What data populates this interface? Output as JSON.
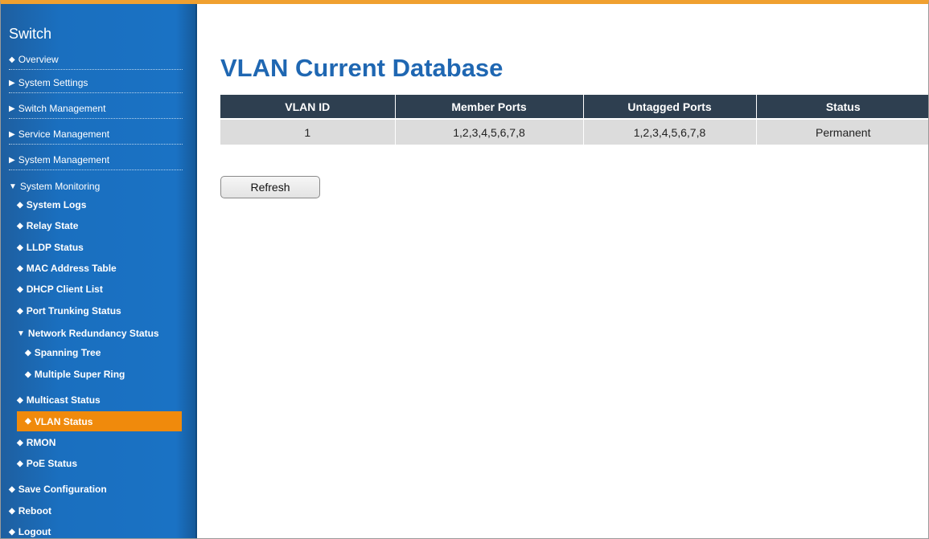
{
  "sidebar": {
    "title": "Switch",
    "items": [
      {
        "marker": "◆",
        "label": "Overview"
      },
      {
        "marker": "▶",
        "label": "System Settings"
      },
      {
        "marker": "▶",
        "label": "Switch Management"
      },
      {
        "marker": "▶",
        "label": "Service Management"
      },
      {
        "marker": "▶",
        "label": "System Management"
      },
      {
        "marker": "▼",
        "label": "System Monitoring"
      },
      {
        "marker": "◆",
        "label": "System Logs"
      },
      {
        "marker": "◆",
        "label": "Relay State"
      },
      {
        "marker": "◆",
        "label": "LLDP Status"
      },
      {
        "marker": "◆",
        "label": "MAC Address Table"
      },
      {
        "marker": "◆",
        "label": "DHCP Client List"
      },
      {
        "marker": "◆",
        "label": "Port Trunking Status"
      },
      {
        "marker": "▼",
        "label": "Network Redundancy Status"
      },
      {
        "marker": "◆",
        "label": "Spanning Tree"
      },
      {
        "marker": "◆",
        "label": "Multiple Super Ring"
      },
      {
        "marker": "◆",
        "label": "Multicast Status"
      },
      {
        "marker": "◆",
        "label": "VLAN Status"
      },
      {
        "marker": "◆",
        "label": "RMON"
      },
      {
        "marker": "◆",
        "label": "PoE Status"
      },
      {
        "marker": "◆",
        "label": "Save Configuration"
      },
      {
        "marker": "◆",
        "label": "Reboot"
      },
      {
        "marker": "◆",
        "label": "Logout"
      }
    ]
  },
  "main": {
    "title": "VLAN Current Database",
    "table": {
      "headers": [
        "VLAN ID",
        "Member Ports",
        "Untagged Ports",
        "Status"
      ],
      "rows": [
        [
          "1",
          "1,2,3,4,5,6,7,8",
          "1,2,3,4,5,6,7,8",
          "Permanent"
        ]
      ]
    },
    "refresh_label": "Refresh"
  },
  "colors": {
    "sidebar": "#1a6fbf",
    "active": "#f08a0c",
    "title": "#1f67b2",
    "table_header": "#2e3f50",
    "top_border": "#f0a030"
  }
}
